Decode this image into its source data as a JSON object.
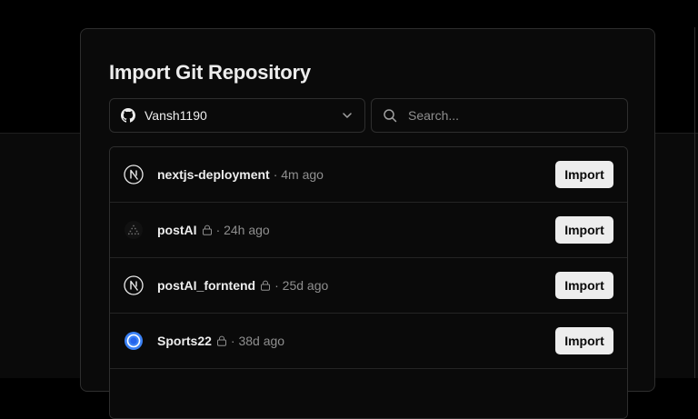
{
  "title": "Import Git Repository",
  "account": {
    "name": "Vansh1190",
    "icon": "github-icon"
  },
  "search": {
    "placeholder": "Search..."
  },
  "repos": [
    {
      "name": "nextjs-deployment",
      "private": false,
      "time": "· 4m ago",
      "icon": "nextjs-icon",
      "action": "Import"
    },
    {
      "name": "postAI",
      "private": true,
      "time": "· 24h ago",
      "icon": "dotted-triangle-icon",
      "action": "Import"
    },
    {
      "name": "postAI_forntend",
      "private": true,
      "time": "· 25d ago",
      "icon": "nextjs-icon",
      "action": "Import"
    },
    {
      "name": "Sports22",
      "private": true,
      "time": "· 38d ago",
      "icon": "blue-circle-icon",
      "action": "Import"
    }
  ],
  "colors": {
    "accent_blue": "#3b82f6",
    "button_bg": "#ededed",
    "border": "#2e2e2e",
    "muted_text": "#8f8f8f"
  }
}
